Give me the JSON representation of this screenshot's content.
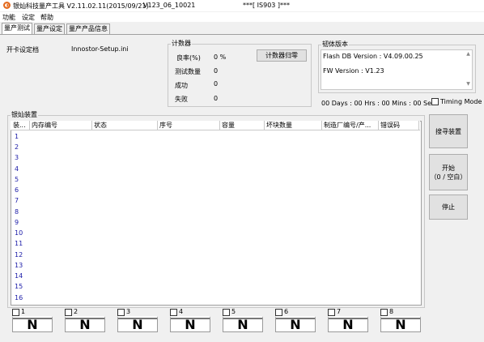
{
  "window": {
    "title": "银灿科技量产工具 V2.11.02.11(2015/09/21)",
    "version_tag": "V123_06_10021",
    "chip_tag": "***[ IS903 ]***"
  },
  "menu": [
    "功能",
    "设定",
    "帮助"
  ],
  "tabs": [
    "量产测试",
    "量产设定",
    "量产产品信息"
  ],
  "settings_file": {
    "label": "开卡设定档",
    "value": "Innostor-Setup.ini"
  },
  "counter": {
    "title": "计数器",
    "yield_label": "良率(%)",
    "yield_value": "0 %",
    "tested_label": "测试数量",
    "tested_value": "0",
    "success_label": "成功",
    "success_value": "0",
    "fail_label": "失败",
    "fail_value": "0",
    "reset_button": "计数器归零"
  },
  "firmware": {
    "title": "韧体版本",
    "flash_db": "Flash DB Version :  V4.09.00.25",
    "fw": "FW Version :    V1.23"
  },
  "timer": "00 Days : 00 Hrs : 00 Mins : 00 Secs",
  "timing_mode": "Timing Mode",
  "devices": {
    "title": "银灿装置",
    "columns": [
      "装...",
      "内存编号",
      "状态",
      "序号",
      "容量",
      "坏块数量",
      "制造厂编号/产...",
      "错误码"
    ],
    "rows": [
      "1",
      "2",
      "3",
      "4",
      "5",
      "6",
      "7",
      "8",
      "9",
      "10",
      "11",
      "12",
      "13",
      "14",
      "15",
      "16"
    ]
  },
  "actions": {
    "search": "搜寻装置",
    "start": "开始\n（0 / 空白）",
    "stop": "停止"
  },
  "ports": [
    {
      "label": "1",
      "status": "N"
    },
    {
      "label": "2",
      "status": "N"
    },
    {
      "label": "3",
      "status": "N"
    },
    {
      "label": "4",
      "status": "N"
    },
    {
      "label": "5",
      "status": "N"
    },
    {
      "label": "6",
      "status": "N"
    },
    {
      "label": "7",
      "status": "N"
    },
    {
      "label": "8",
      "status": "N"
    }
  ]
}
